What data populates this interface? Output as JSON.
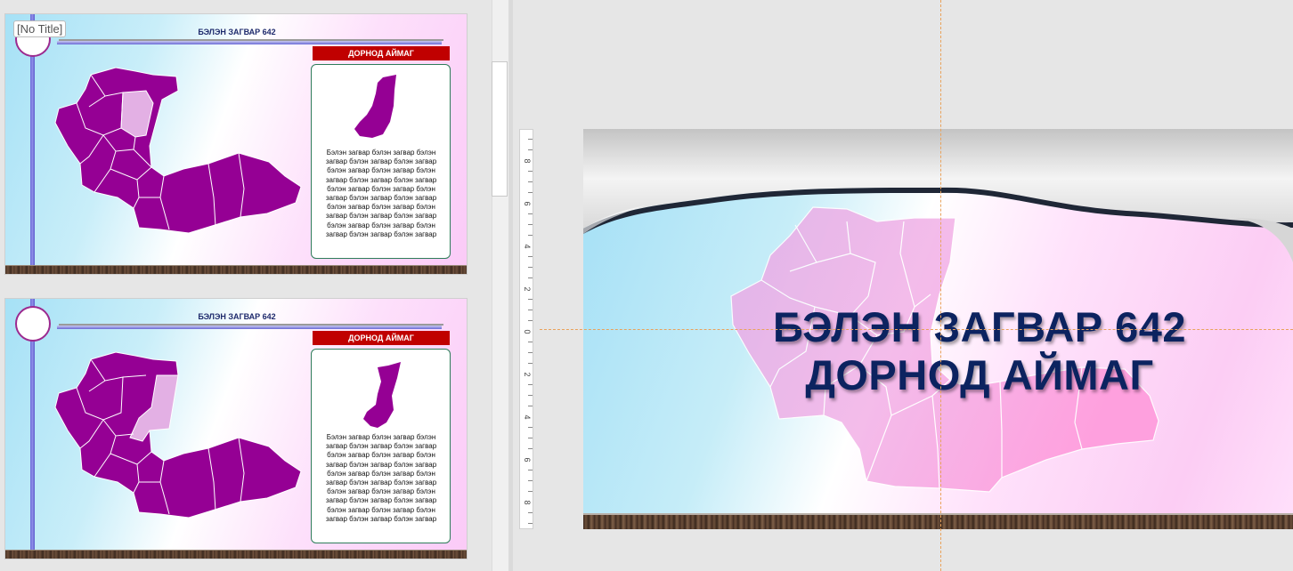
{
  "slides": [
    {
      "header": "БЭЛЭН ЗАГВАР 642",
      "banner": "ДОРНОД АЙМАГ",
      "body": "Бэлэн загвар бэлэн загвар бэлэн загвар бэлэн загвар бэлэн загвар бэлэн загвар бэлэн загвар бэлэн загвар бэлэн загвар бэлэн загвар бэлэн загвар бэлэн загвар бэлэн загвар бэлэн загвар бэлэн загвар бэлэн загвар бэлэн загвар бэлэн загвар бэлэн загвар бэлэн загвар бэлэн загвар бэлэн загвар бэлэн загвар бэлэн загвар бэлэн загвар",
      "tooltip": "[No Title]"
    },
    {
      "header": "БЭЛЭН ЗАГВАР 642",
      "banner": "ДОРНОД АЙМАГ",
      "body": "Бэлэн загвар бэлэн загвар бэлэн загвар бэлэн загвар бэлэн загвар бэлэн загвар бэлэн загвар бэлэн загвар бэлэн загвар бэлэн загвар бэлэн загвар бэлэн загвар бэлэн загвар бэлэн загвар бэлэн загвар бэлэн загвар бэлэн загвар бэлэн загвар бэлэн загвар бэлэн загвар бэлэн загвар бэлэн загвар бэлэн загвар бэлэн загвар бэлэн загвар"
    }
  ],
  "main_slide": {
    "title_line1": "БЭЛЭН ЗАГВАР 642",
    "title_line2": "ДОРНОД АЙМАГ"
  },
  "ruler": {
    "labels": [
      "8",
      "6",
      "4",
      "2",
      "0",
      "2",
      "4",
      "6",
      "8"
    ]
  },
  "colors": {
    "map_fill": "#950094",
    "map_highlight": "#e3b0e4",
    "banner": "#c00000",
    "title": "#0c2360"
  }
}
